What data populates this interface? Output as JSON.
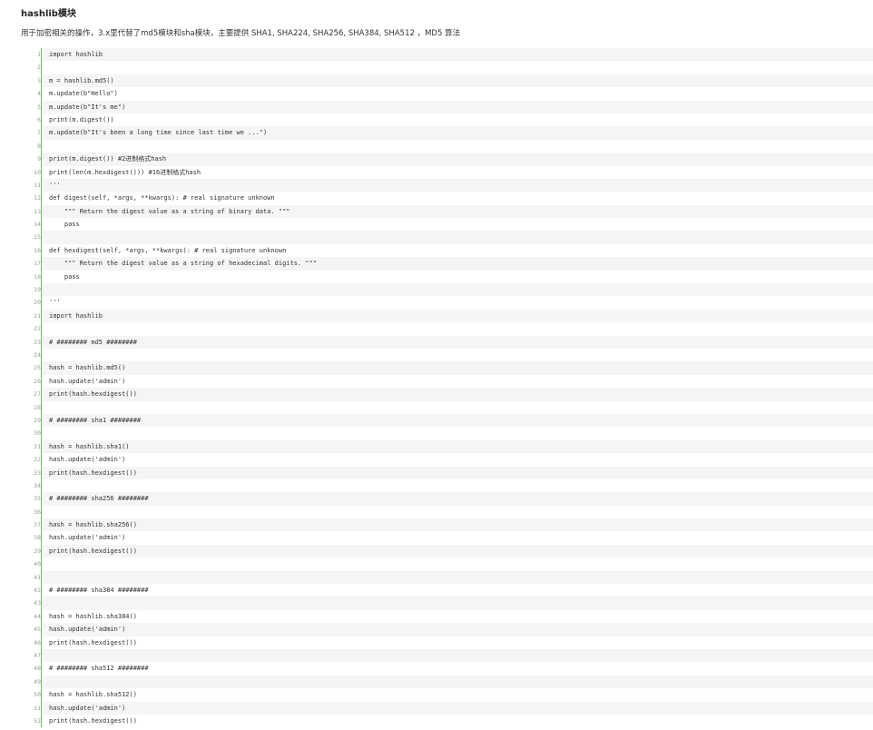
{
  "title": "hashlib模块",
  "description": "用于加密相关的操作，3.x里代替了md5模块和sha模块，主要提供 SHA1, SHA224, SHA256, SHA384, SHA512 ，MD5 算法",
  "code_lines": [
    "import hashlib",
    "",
    "m = hashlib.md5()",
    "m.update(b\"Hello\")",
    "m.update(b\"It's me\")",
    "print(m.digest())",
    "m.update(b\"It's been a long time since last time we ...\")",
    "",
    "print(m.digest()) #2进制格式hash",
    "print(len(m.hexdigest())) #16进制格式hash",
    "'''",
    "def digest(self, *args, **kwargs): # real signature unknown",
    "    \"\"\" Return the digest value as a string of binary data. \"\"\"",
    "    pass",
    "",
    "def hexdigest(self, *args, **kwargs): # real signature unknown",
    "    \"\"\" Return the digest value as a string of hexadecimal digits. \"\"\"",
    "    pass",
    "",
    "'''",
    "import hashlib",
    "",
    "# ######## md5 ########",
    "",
    "hash = hashlib.md5()",
    "hash.update('admin')",
    "print(hash.hexdigest())",
    "",
    "# ######## sha1 ########",
    "",
    "hash = hashlib.sha1()",
    "hash.update('admin')",
    "print(hash.hexdigest())",
    "",
    "# ######## sha256 ########",
    "",
    "hash = hashlib.sha256()",
    "hash.update('admin')",
    "print(hash.hexdigest())",
    "",
    "",
    "# ######## sha384 ########",
    "",
    "hash = hashlib.sha384()",
    "hash.update('admin')",
    "print(hash.hexdigest())",
    "",
    "# ######## sha512 ########",
    "",
    "hash = hashlib.sha512()",
    "hash.update('admin')",
    "print(hash.hexdigest())"
  ]
}
